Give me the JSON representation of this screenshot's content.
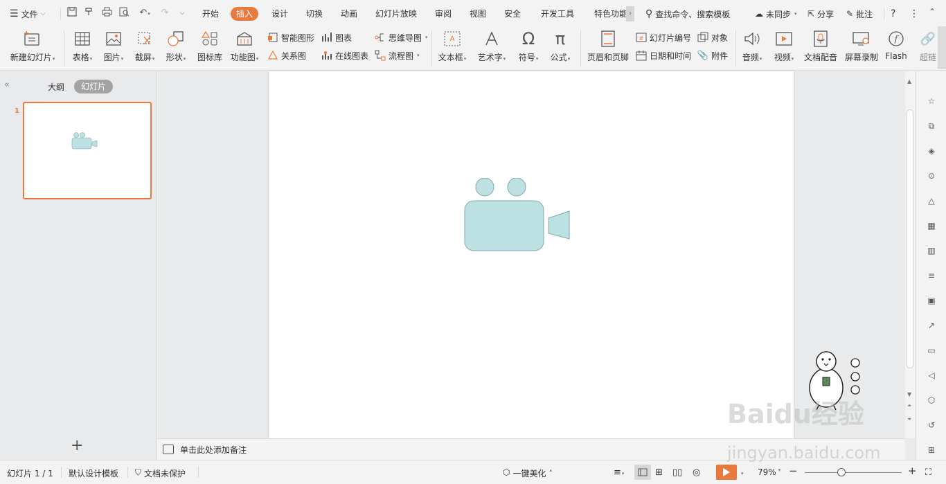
{
  "menu": {
    "file_label": "文件"
  },
  "tabs": [
    {
      "label": "开始"
    },
    {
      "label": "插入"
    },
    {
      "label": "设计"
    },
    {
      "label": "切换"
    },
    {
      "label": "动画"
    },
    {
      "label": "幻灯片放映"
    },
    {
      "label": "审阅"
    },
    {
      "label": "视图"
    },
    {
      "label": "安全"
    },
    {
      "label": "开发工具"
    },
    {
      "label": "特色功能"
    }
  ],
  "search": {
    "placeholder": "查找命令、搜索模板"
  },
  "topright": {
    "sync_label": "未同步",
    "share_label": "分享",
    "comment_label": "批注",
    "help_label": "?",
    "more_label": "⋮"
  },
  "ribbon": {
    "new_slide": "新建幻灯片",
    "table": "表格",
    "picture": "图片",
    "screenshot": "截屏",
    "shape": "形状",
    "icon_lib": "图标库",
    "func_chart": "功能图",
    "smart_shape": "智能图形",
    "chart": "图表",
    "mindmap": "思维导图",
    "relation": "关系图",
    "online_chart": "在线图表",
    "flowchart": "流程图",
    "textbox": "文本框",
    "wordart": "艺术字",
    "symbol": "符号",
    "formula": "公式",
    "header_footer": "页眉和页脚",
    "slide_number": "幻灯片编号",
    "object": "对象",
    "datetime": "日期和时间",
    "attachment": "附件",
    "audio": "音频",
    "video": "视频",
    "doc_dub": "文档配音",
    "screen_rec": "屏幕录制",
    "flash": "Flash",
    "hyperlink": "超链"
  },
  "left_pane": {
    "outline_tab": "大纲",
    "slides_tab": "幻灯片",
    "slide_number": "1",
    "add_label": "+"
  },
  "notes": {
    "placeholder": "单击此处添加备注"
  },
  "status": {
    "slide_pos": "幻灯片 1 / 1",
    "template": "默认设计模板",
    "protect": "文档未保护",
    "beautify": "一键美化",
    "zoom": "79%",
    "minus": "−",
    "plus": "+"
  },
  "colors": {
    "accent": "#e8793f",
    "camera_fill": "#bde0e3",
    "camera_stroke": "#7fa9ae"
  },
  "watermark": {
    "text": "Baidu经验",
    "sub": "jingyan.baidu.com"
  }
}
